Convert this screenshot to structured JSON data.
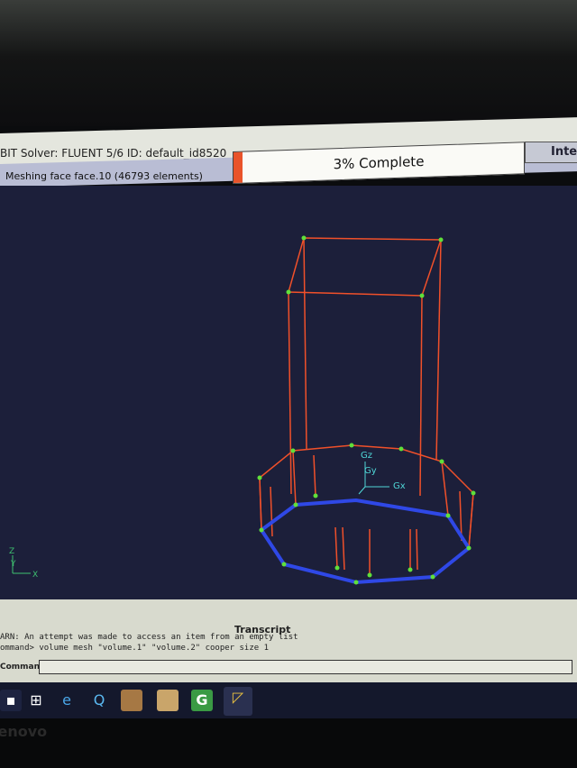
{
  "app": {
    "title": "BIT   Solver: FLUENT 5/6   ID: default_id8520",
    "interrupt_label": "Inter"
  },
  "status": {
    "message": "Meshing face face.10 (46793 elements)",
    "progress_percent": 3,
    "progress_label": "3% Complete"
  },
  "viewport": {
    "labels": {
      "gx": "Gx",
      "gy": "Gy",
      "gz": "Gz"
    },
    "axes": {
      "x": "X",
      "y": "Y",
      "z": "Z"
    },
    "colors": {
      "edges": "#f0502a",
      "vertices": "#5fe03a",
      "selected": "#2f48e6",
      "labels": "#4fd6d6"
    }
  },
  "transcript": {
    "title": "Transcript",
    "lines": [
      "ARN:   An attempt was made to access an item from an empty list",
      "ommand> volume mesh \"volume.1\" \"volume.2\" cooper size 1"
    ],
    "command_label": "Command:",
    "command_value": ""
  },
  "taskbar": {
    "icons": [
      "windows-start-icon",
      "store-icon",
      "internet-explorer-icon",
      "app-q-icon",
      "photo-app-icon",
      "package-icon",
      "gambit-icon",
      "gambit-active-icon"
    ]
  },
  "bezel": {
    "brand": "lenovo"
  }
}
